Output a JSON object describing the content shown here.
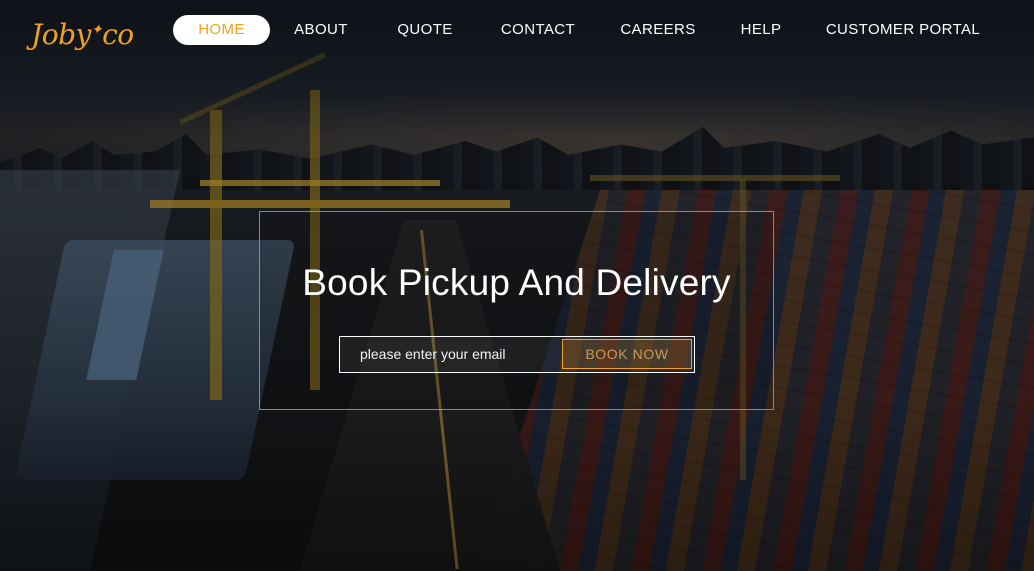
{
  "brand": {
    "logo_text": "Jobyco",
    "logo_prefix": "Joby",
    "logo_suffix": "co",
    "accent_color": "#f0a21d"
  },
  "nav": {
    "items": [
      {
        "label": "HOME",
        "active": true
      },
      {
        "label": "ABOUT",
        "active": false
      },
      {
        "label": "QUOTE",
        "active": false
      },
      {
        "label": "CONTACT",
        "active": false
      },
      {
        "label": "CAREERS",
        "active": false
      },
      {
        "label": "HELP",
        "active": false
      },
      {
        "label": "CUSTOMER PORTAL",
        "active": false
      }
    ]
  },
  "hero": {
    "title": "Book Pickup And Delivery",
    "email_placeholder": "please enter your email",
    "email_value": "",
    "button_label": "BOOK NOW"
  }
}
